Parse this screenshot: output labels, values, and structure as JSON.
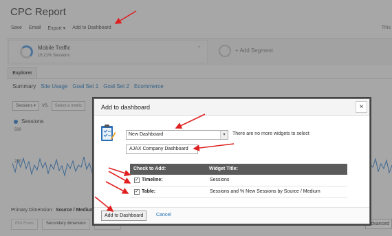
{
  "report": {
    "title": "CPC Report",
    "toolbar": [
      "Save",
      "Email",
      "Export ▾",
      "Add to Dashboard"
    ],
    "right_label": "This"
  },
  "segment": {
    "name": "Mobile Traffic",
    "sub": "16.21% Sessions",
    "chevron": "⌄",
    "add_label": "+ Add Segment"
  },
  "explorer": {
    "tab": "Explorer",
    "subnav": [
      "Summary",
      "Site Usage",
      "Goal Set 1",
      "Goal Set 2",
      "Ecommerce"
    ]
  },
  "metrics": {
    "primary": "Sessions",
    "primary_arrow": "▾",
    "vs": "VS.",
    "secondary": "Select a metric"
  },
  "chart": {
    "legend": "Sessions",
    "y_top": "500",
    "y_mid": "250",
    "color": "#2f7ac6"
  },
  "bottom": {
    "primary_dimension_label": "Primary Dimension:",
    "primary_dimension_value": "Source / Medium",
    "buttons": [
      "Plot Rows",
      "Secondary dimension",
      "Sort Type:"
    ],
    "advanced": "Advanced"
  },
  "modal": {
    "title": "Add to dashboard",
    "close": "×",
    "dashboard_select": "New Dashboard",
    "select_arrow": "▾",
    "no_more_text": "There are no more widgets to select",
    "dashboard_name": "AJAX Company Dashboard",
    "table": {
      "col1": "Check to Add:",
      "col2": "Widget Title:",
      "rows": [
        {
          "checked": "✓",
          "label": "Timeline:",
          "title": "Sessions"
        },
        {
          "checked": "✓",
          "label": "Table:",
          "title": "Sessions and % New Sessions by Source / Medium"
        }
      ]
    },
    "add_button": "Add to Dashboard",
    "cancel": "Cancel"
  },
  "annotation_color": "#e02020"
}
